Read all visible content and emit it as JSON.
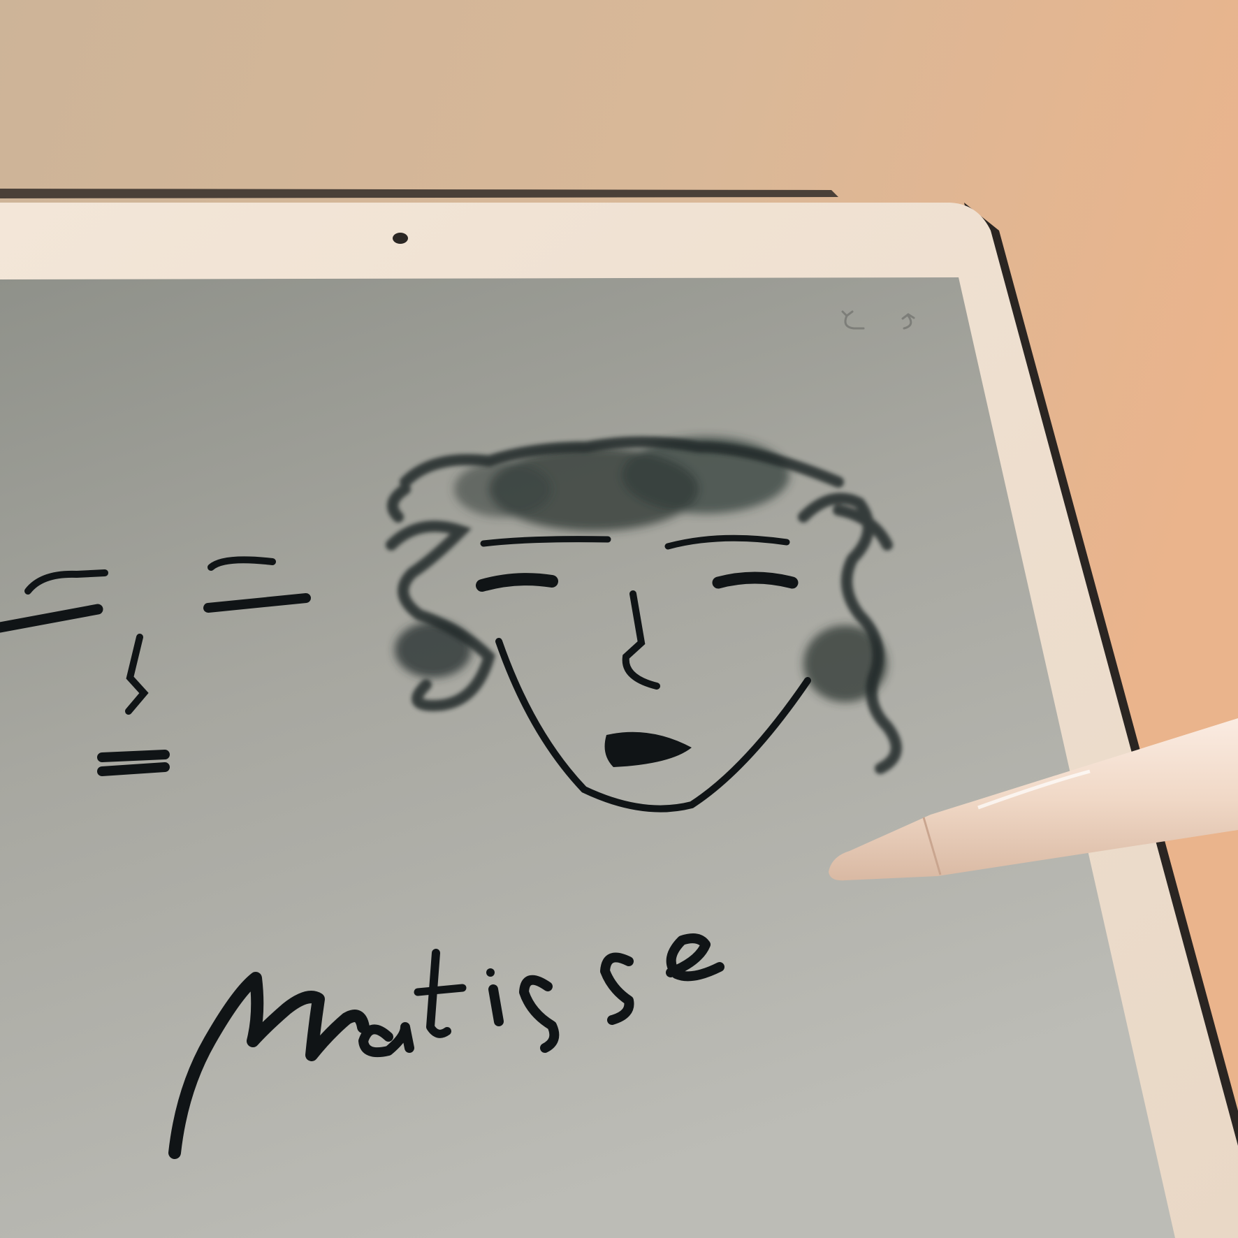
{
  "photo": {
    "wall_colors": [
      "#e8c3a2",
      "#d8b896",
      "#b8a688"
    ],
    "device_frame_color": "#efe3d4",
    "screen_colors": [
      "#9e9d93",
      "#b3b3ab",
      "#c6c6c0"
    ],
    "ink_color": "#101416",
    "pencil_color": "#f1dccd"
  },
  "toolbar": {
    "undo_icon": "undo-arrow-icon",
    "redo_icon": "redo-arrow-icon"
  },
  "drawing": {
    "handwritten_signature": "Matisse",
    "subject": "face-sketch"
  }
}
